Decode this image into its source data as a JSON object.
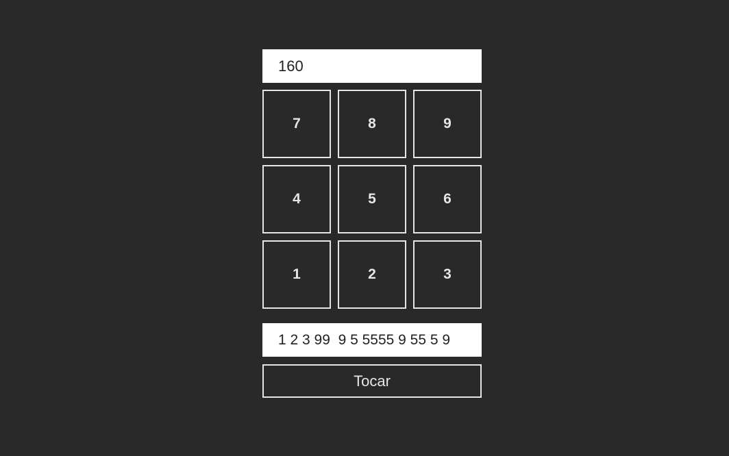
{
  "tempo_input": {
    "value": "160"
  },
  "keypad": {
    "keys": [
      {
        "label": "7"
      },
      {
        "label": "8"
      },
      {
        "label": "9"
      },
      {
        "label": "4"
      },
      {
        "label": "5"
      },
      {
        "label": "6"
      },
      {
        "label": "1"
      },
      {
        "label": "2"
      },
      {
        "label": "3"
      }
    ]
  },
  "sequence_input": {
    "value": "1 2 3 99  9 5 5555 9 55 5 9"
  },
  "play_button": {
    "label": "Tocar"
  },
  "colors": {
    "background": "#292929",
    "border": "#e6e6e6",
    "input_background": "#ffffff"
  }
}
